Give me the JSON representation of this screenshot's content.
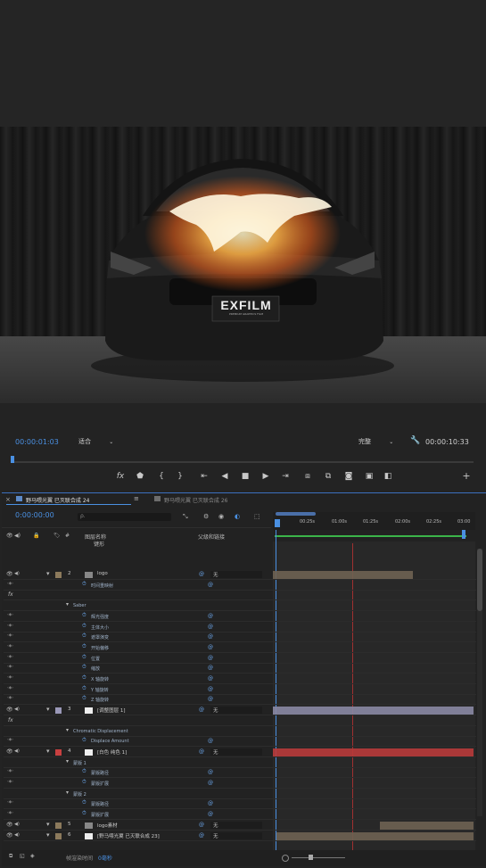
{
  "viewer": {
    "timecode": "00:00:01:03",
    "fit": "适合",
    "quality": "完整",
    "duration": "00:00:10:33",
    "logo_main": "EXFILM",
    "logo_sub": "PREMIUM GRAPHICS FILM"
  },
  "transport": {
    "icons": [
      "fx-icon",
      "marker-icon",
      "in-point-icon",
      "out-point-icon",
      "goto-in-icon",
      "step-back-icon",
      "stop-icon",
      "step-forward-icon",
      "goto-out-icon",
      "insert-icon",
      "overwrite-icon",
      "export-frame-icon",
      "button-editor-icon",
      "compare-icon",
      "add-icon"
    ]
  },
  "panel": {
    "tabs": [
      "野马喂光翼 已灭联合成 24",
      "野马喂光翼 已灭联合成 26"
    ],
    "timecode": "0:00:00:00",
    "search_placeholder": "ρ.",
    "col_layer": "图层名称",
    "col_layer_sub": "键形",
    "col_parent": "父级和链接",
    "col_num": "#",
    "ruler": [
      "00:25s",
      "01:00s",
      "01:25s",
      "02:00s",
      "02:25s",
      "03:00"
    ],
    "footer": "帧渲染时间",
    "footer_value": "0毫秒",
    "rows": [
      {
        "type": "layer",
        "num": "2",
        "name": "logo",
        "label_color": "#8c7a5c",
        "parent": "无"
      },
      {
        "type": "prop",
        "name": "时间重映射"
      },
      {
        "type": "fx",
        "name": ""
      },
      {
        "type": "group",
        "name": "Saber"
      },
      {
        "type": "prop",
        "name": "辉光强度"
      },
      {
        "type": "prop",
        "name": "主体大小"
      },
      {
        "type": "prop",
        "name": "遮罩演变"
      },
      {
        "type": "prop",
        "name": "开始偏移"
      },
      {
        "type": "prop",
        "name": "位置"
      },
      {
        "type": "prop",
        "name": "缩放"
      },
      {
        "type": "prop",
        "name": "X 轴旋转"
      },
      {
        "type": "prop",
        "name": "Y 轴旋转"
      },
      {
        "type": "prop",
        "name": "Z 轴旋转"
      },
      {
        "type": "layer",
        "num": "3",
        "name": "[调整图层 1]",
        "label_color": "#9a98b8",
        "parent": "无"
      },
      {
        "type": "fx",
        "name": ""
      },
      {
        "type": "group",
        "name": "Chromatic Displacement"
      },
      {
        "type": "prop",
        "name": "Displace Amount"
      },
      {
        "type": "layer",
        "num": "4",
        "name": "[白色 纯色 1]",
        "label_color": "#c84040",
        "parent": "无"
      },
      {
        "type": "group",
        "name": "蒙版 1"
      },
      {
        "type": "prop",
        "name": "蒙版路径"
      },
      {
        "type": "prop",
        "name": "蒙版扩展"
      },
      {
        "type": "group",
        "name": "蒙版 2"
      },
      {
        "type": "prop",
        "name": "蒙版路径"
      },
      {
        "type": "prop",
        "name": "蒙版扩展"
      },
      {
        "type": "layer",
        "num": "5",
        "name": "logo素材",
        "label_color": "#8c7a5c",
        "parent": "无"
      },
      {
        "type": "layer",
        "num": "6",
        "name": "[野马喂光翼 已灭联合成 23]",
        "label_color": "#8c7a5c",
        "parent": "无"
      }
    ]
  },
  "colors": {
    "accent": "#4a90e2",
    "work_area": "#3bb54a",
    "playhead": "#e03030"
  }
}
